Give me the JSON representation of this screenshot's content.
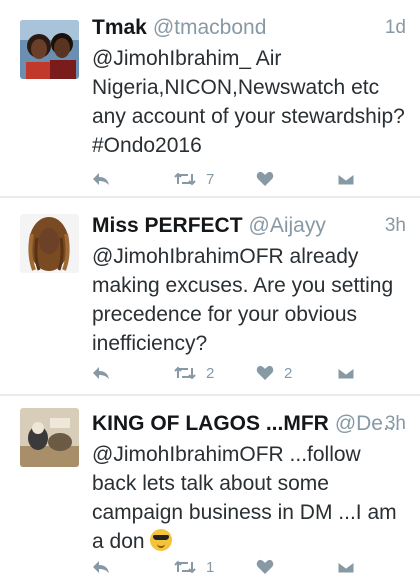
{
  "tweets": [
    {
      "name": "Tmak",
      "handle": "@tmacbond",
      "time": "1d",
      "text": "@JimohIbrahim_ Air Nigeria,NICON,Newswatch etc any account of your stewardship?#Ondo2016",
      "retweets": "7",
      "likes": "",
      "avatar_icon": "couple-selfie-avatar"
    },
    {
      "name": "Miss PERFECT",
      "handle": "@Aijayy",
      "time": "3h",
      "text": "@JimohIbrahimOFR already making excuses. Are you setting precedence for your obvious inefficiency?",
      "retweets": "2",
      "likes": "2",
      "avatar_icon": "braided-hair-woman-avatar"
    },
    {
      "name": "KING OF LAGOS ...MFR",
      "handle": "@De...",
      "time": "3h",
      "text": "@JimohIbrahimOFR ...follow back lets talk about some campaign business in DM ...I am a don",
      "emoji": "smiling-face-with-sunglasses",
      "retweets": "1",
      "likes": "",
      "avatar_icon": "cartoon-scene-avatar"
    }
  ],
  "colors": {
    "background": "#e6ecf0",
    "card": "#ffffff",
    "muted": "#8899a6",
    "text": "#292f33"
  }
}
